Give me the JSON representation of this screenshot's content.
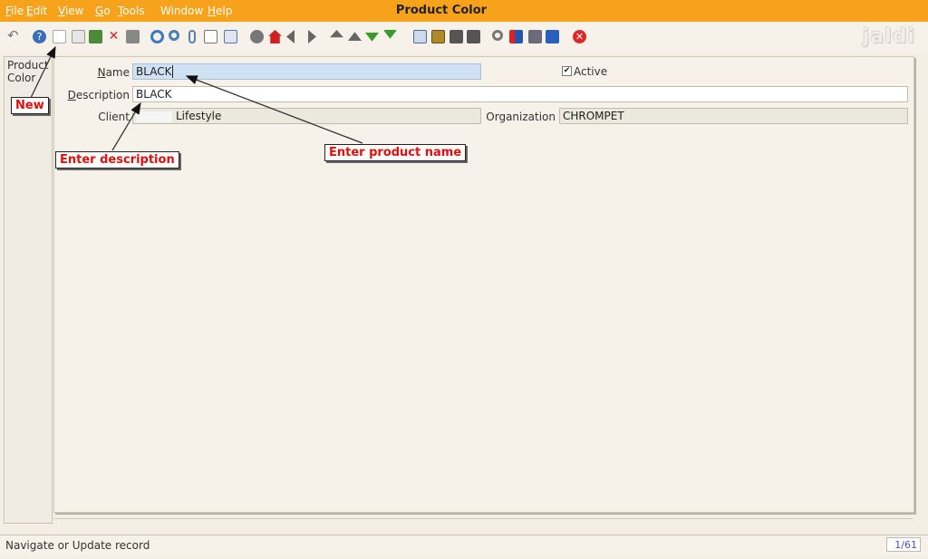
{
  "menubar": {
    "items": [
      {
        "label": "File",
        "ul": "F"
      },
      {
        "label": "Edit",
        "ul": "E"
      },
      {
        "label": "View",
        "ul": "V"
      },
      {
        "label": "Go",
        "ul": "G"
      },
      {
        "label": "Tools",
        "ul": "T"
      },
      {
        "label": "Window",
        "ul": ""
      },
      {
        "label": "Help",
        "ul": "H"
      }
    ],
    "title": "Product Color"
  },
  "toolbar": {
    "icons": [
      "undo-icon",
      "help-icon",
      "new-record-icon",
      "copy-record-icon",
      "save-icon",
      "delete-icon",
      "report-icon",
      "refresh-icon",
      "find-icon",
      "attachment-icon",
      "chat-icon",
      "grid-toggle-icon",
      "history-icon",
      "home-icon",
      "back-icon",
      "forward-icon",
      "first-record-icon",
      "previous-record-icon",
      "next-record-icon",
      "last-record-icon",
      "detail-icon",
      "archive-icon",
      "print-preview-icon",
      "print-icon",
      "zoom-across-icon",
      "workflow-icon",
      "process-icon",
      "product-info-icon",
      "close-window-icon"
    ]
  },
  "brand": {
    "logo_text": "jaldi"
  },
  "leftpane": {
    "tab_label": "Product Color"
  },
  "form": {
    "name_label": "Name",
    "name_value": "BLACK",
    "active_label": "Active",
    "active_checked": true,
    "description_label": "Description",
    "description_value": "BLACK",
    "client_label": "Client",
    "client_value": "Lifestyle",
    "organization_label": "Organization",
    "organization_value": "CHROMPET"
  },
  "annotations": {
    "new": "New",
    "enter_description": "Enter description",
    "enter_product_name": "Enter product name"
  },
  "status": {
    "message": "Navigate or Update record",
    "pager": "1/61"
  },
  "colors": {
    "menubar": "#f7a21b",
    "accent_red": "#e01010",
    "field_highlight": "#cfe1f3"
  }
}
